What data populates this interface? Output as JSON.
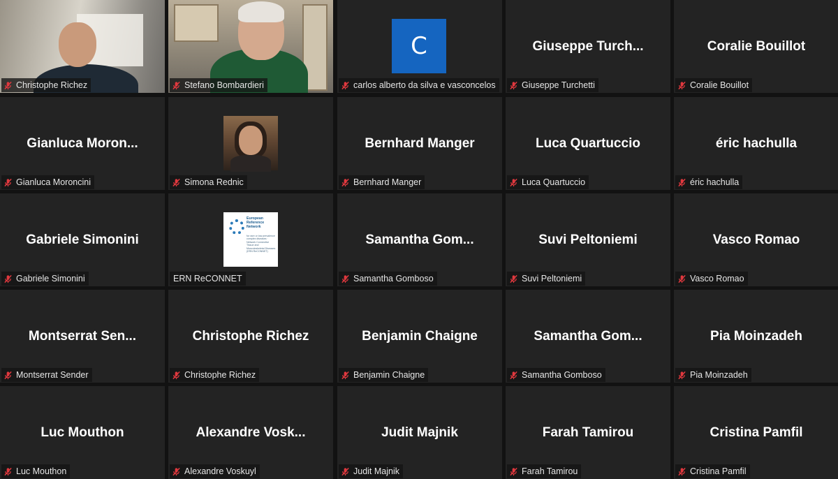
{
  "participants": [
    {
      "label": "Christophe Richez",
      "display": "",
      "muted": true,
      "type": "video"
    },
    {
      "label": "Stefano Bombardieri",
      "display": "",
      "muted": true,
      "type": "video"
    },
    {
      "label": "carlos alberto da silva e vasconcelos",
      "display": "",
      "muted": true,
      "type": "avatar-letter",
      "avatar_letter": "C",
      "avatar_color": "#1565c0"
    },
    {
      "label": "Giuseppe Turchetti",
      "display": "Giuseppe  Turch...",
      "muted": true,
      "type": "name"
    },
    {
      "label": "Coralie Bouillot",
      "display": "Coralie Bouillot",
      "muted": true,
      "type": "name"
    },
    {
      "label": "Gianluca Moroncini",
      "display": "Gianluca  Moron...",
      "muted": true,
      "type": "name"
    },
    {
      "label": "Simona Rednic",
      "display": "",
      "muted": true,
      "type": "photo"
    },
    {
      "label": "Bernhard Manger",
      "display": "Bernhard Manger",
      "muted": true,
      "type": "name"
    },
    {
      "label": "Luca Quartuccio",
      "display": "Luca Quartuccio",
      "muted": true,
      "type": "name"
    },
    {
      "label": "éric hachulla",
      "display": "éric hachulla",
      "muted": true,
      "type": "name"
    },
    {
      "label": "Gabriele Simonini",
      "display": "Gabriele Simonini",
      "muted": true,
      "type": "name"
    },
    {
      "label": "ERN ReCONNET",
      "display": "",
      "muted": false,
      "type": "logo",
      "logo_title": "European Reference Network",
      "logo_subtitle": "for rare or low prevalence complex diseases · Network Connective Tissue and Musculoskeletal Diseases (ERN ReCONNET)"
    },
    {
      "label": "Samantha Gomboso",
      "display": "Samantha  Gom...",
      "muted": true,
      "type": "name"
    },
    {
      "label": "Suvi Peltoniemi",
      "display": "Suvi Peltoniemi",
      "muted": true,
      "type": "name"
    },
    {
      "label": "Vasco Romao",
      "display": "Vasco Romao",
      "muted": true,
      "type": "name"
    },
    {
      "label": "Montserrat Sender",
      "display": "Montserrat  Sen...",
      "muted": true,
      "type": "name"
    },
    {
      "label": "Christophe Richez",
      "display": "Christophe Richez",
      "muted": true,
      "type": "name"
    },
    {
      "label": "Benjamin Chaigne",
      "display": "Benjamin Chaigne",
      "muted": true,
      "type": "name"
    },
    {
      "label": "Samantha Gomboso",
      "display": "Samantha  Gom...",
      "muted": true,
      "type": "name"
    },
    {
      "label": "Pia Moinzadeh",
      "display": "Pia Moinzadeh",
      "muted": true,
      "type": "name"
    },
    {
      "label": "Luc Mouthon",
      "display": "Luc Mouthon",
      "muted": true,
      "type": "name"
    },
    {
      "label": "Alexandre Voskuyl",
      "display": "Alexandre  Vosk...",
      "muted": true,
      "type": "name"
    },
    {
      "label": "Judit Majnik",
      "display": "Judit Majnik",
      "muted": true,
      "type": "name"
    },
    {
      "label": "Farah Tamirou",
      "display": "Farah Tamirou",
      "muted": true,
      "type": "name"
    },
    {
      "label": "Cristina Pamfil",
      "display": "Cristina Pamfil",
      "muted": true,
      "type": "name"
    }
  ],
  "colors": {
    "background": "#121212",
    "tile": "#232323",
    "muted_icon": "#e0383e",
    "text": "#ffffff"
  },
  "icons": {
    "muted": "microphone-muted-icon"
  }
}
